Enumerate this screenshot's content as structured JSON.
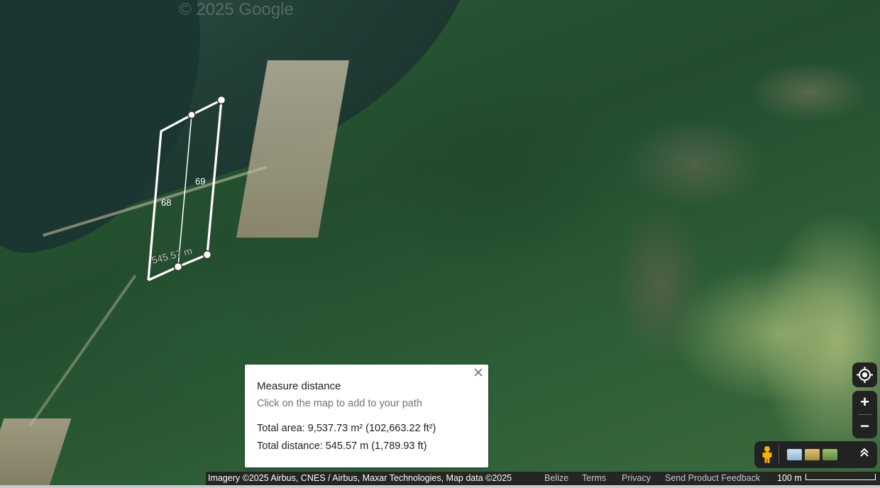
{
  "map": {
    "watermark": "© 2025 Google",
    "measure": {
      "segment_labels": [
        "68",
        "69",
        "545.57 m"
      ]
    }
  },
  "info_card": {
    "title": "Measure distance",
    "hint": "Click on the map to add to your path",
    "total_area": "Total area: 9,537.73 m² (102,663.22 ft²)",
    "total_distance": "Total distance: 545.57 m (1,789.93 ft)",
    "close_icon": "close-icon"
  },
  "controls": {
    "zoom_in": "+",
    "zoom_out": "−",
    "locate_icon": "my-location-icon",
    "layers_expand_icon": "chevron-up-double-icon",
    "pegman_icon": "pegman-icon"
  },
  "footer": {
    "imagery": "Imagery ©2025 Airbus, CNES / Airbus, Maxar Technologies, Map data ©2025",
    "region": "Belize",
    "terms": "Terms",
    "privacy": "Privacy",
    "feedback": "Send Product Feedback",
    "scale": "100 m"
  },
  "colors": {
    "panel": "#222222",
    "measure_line": "#ffffff",
    "card_text": "#202124",
    "card_hint": "#70757a"
  }
}
